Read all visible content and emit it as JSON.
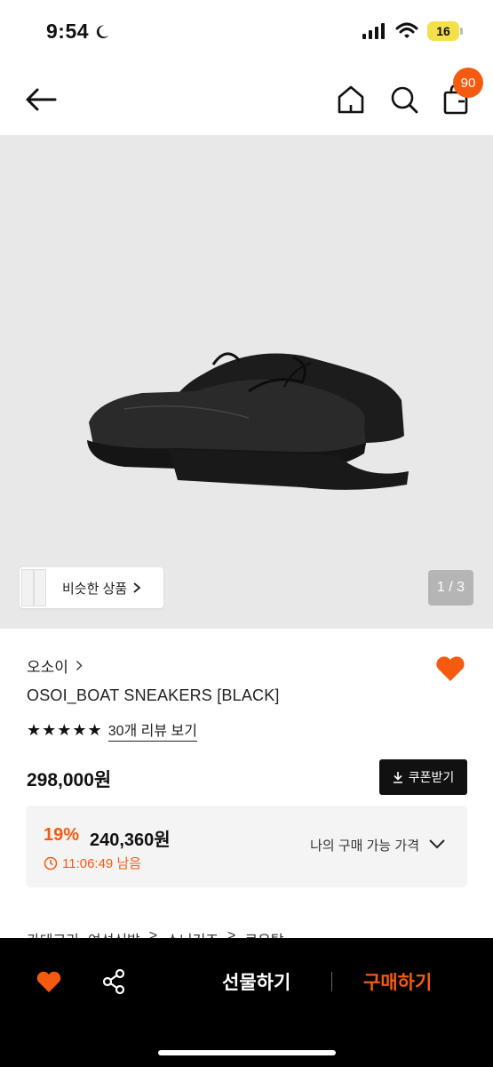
{
  "status": {
    "time": "9:54",
    "battery": "16"
  },
  "nav": {
    "cart_count": "90"
  },
  "hero": {
    "similar_label": "비슷한 상품",
    "page": "1 / 3"
  },
  "product": {
    "brand": "오소이",
    "name": "OSOI_BOAT SNEAKERS [BLACK]",
    "stars": "★★★★★",
    "rating": 5,
    "review_link": "30개 리뷰 보기",
    "price": "298,000원",
    "coupon_label": "쿠폰받기",
    "discount_pct": "19%",
    "discount_price": "240,360원",
    "timer": "11:06:49 남음",
    "my_price_label": "나의 구매 가능 가격"
  },
  "category": {
    "label": "카테고리",
    "path": [
      "여성신발",
      ">",
      "스니커즈",
      ">",
      "로우탑"
    ]
  },
  "bottom": {
    "gift_label": "선물하기",
    "buy_label": "구매하기"
  },
  "colors": {
    "accent": "#f45b11",
    "bar": "#000000"
  }
}
